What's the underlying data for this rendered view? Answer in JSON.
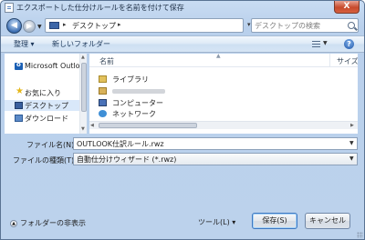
{
  "window": {
    "title": "エクスポートした仕分けルールを名前を付けて保存",
    "close_label": "X"
  },
  "address": {
    "path": "デスクトップ",
    "search_placeholder": "デスクトップの検索"
  },
  "toolbar": {
    "organize_label": "整理 ▾",
    "new_folder_label": "新しいフォルダー"
  },
  "nav_pane": {
    "items": [
      {
        "label": "Microsoft Outlook",
        "icon": "outlook-icon"
      },
      {
        "label": "お気に入り",
        "icon": "star-icon"
      },
      {
        "label": "デスクトップ",
        "icon": "desktop-folder-icon",
        "selected": true
      },
      {
        "label": "ダウンロード",
        "icon": "download-folder-icon"
      }
    ]
  },
  "file_list": {
    "columns": {
      "name": "名前",
      "size": "サイズ"
    },
    "items": [
      {
        "label": "ライブラリ",
        "icon": "library-icon"
      },
      {
        "label": "",
        "icon": "user-folder-icon"
      },
      {
        "label": "コンピューター",
        "icon": "computer-icon"
      },
      {
        "label": "ネットワーク",
        "icon": "network-icon"
      }
    ]
  },
  "form": {
    "filename_label": "ファイル名(N):",
    "filename_value": "OUTLOOK仕訳ルール.rwz",
    "filetype_label": "ファイルの種類(T):",
    "filetype_value": "自動仕分けウィザード (*.rwz)"
  },
  "footer": {
    "hide_folders_label": "フォルダーの非表示",
    "tools_label": "ツール(L) ▾",
    "save_label": "保存(S)",
    "cancel_label": "キャンセル"
  }
}
